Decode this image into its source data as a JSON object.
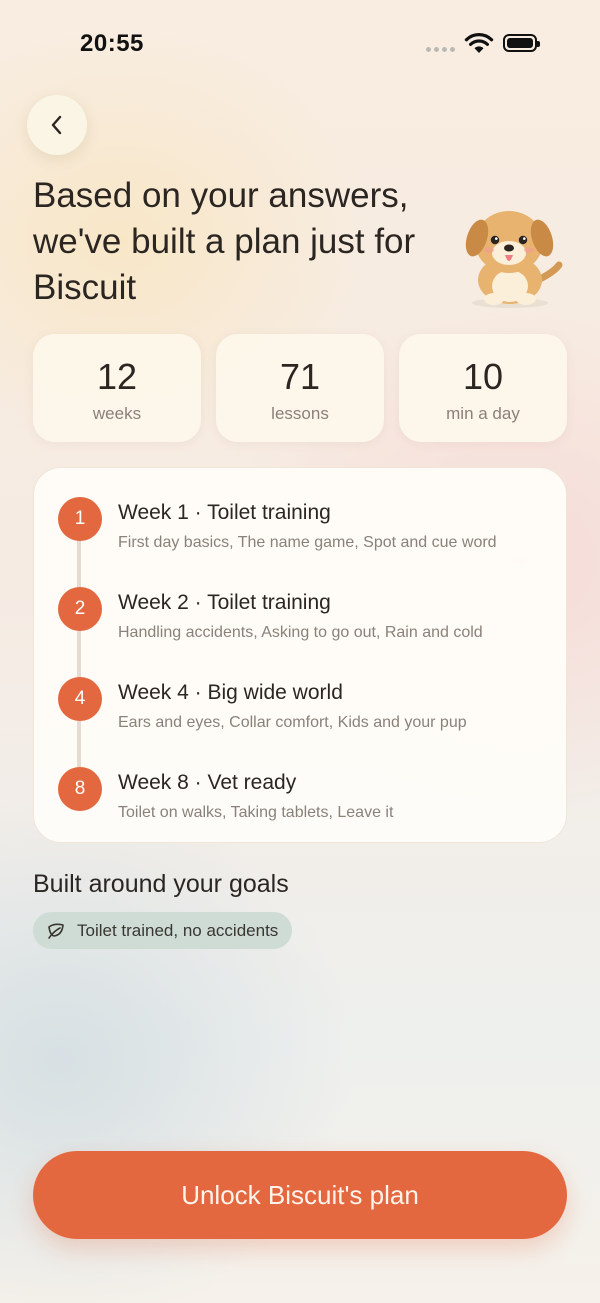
{
  "status_bar": {
    "time": "20:55"
  },
  "heading": "Based on your answers, we've built a plan just for Biscuit",
  "stats": [
    {
      "value": "12",
      "label": "weeks"
    },
    {
      "value": "71",
      "label": "lessons"
    },
    {
      "value": "10",
      "label": "min a day"
    }
  ],
  "plan": {
    "steps": [
      {
        "number": "1",
        "title": "Week 1 · Toilet training",
        "subtitle": "First day basics, The name game, Spot and cue word"
      },
      {
        "number": "2",
        "title": "Week 2 · Toilet training",
        "subtitle": "Handling accidents, Asking to go out, Rain and cold"
      },
      {
        "number": "4",
        "title": "Week 4 · Big wide world",
        "subtitle": "Ears and eyes, Collar comfort, Kids and your pup"
      },
      {
        "number": "8",
        "title": "Week 8 · Vet ready",
        "subtitle": "Toilet on walks, Taking tablets, Leave it"
      }
    ]
  },
  "goals": {
    "title": "Built around your goals",
    "chips": [
      {
        "icon": "leaf-icon",
        "label": "Toilet trained, no accidents"
      }
    ]
  },
  "cta": {
    "label": "Unlock Biscuit's plan"
  },
  "colors": {
    "accent": "#e4683f",
    "chip_bg": "#cfdcd5",
    "card_bg": "#fdf7ec"
  }
}
